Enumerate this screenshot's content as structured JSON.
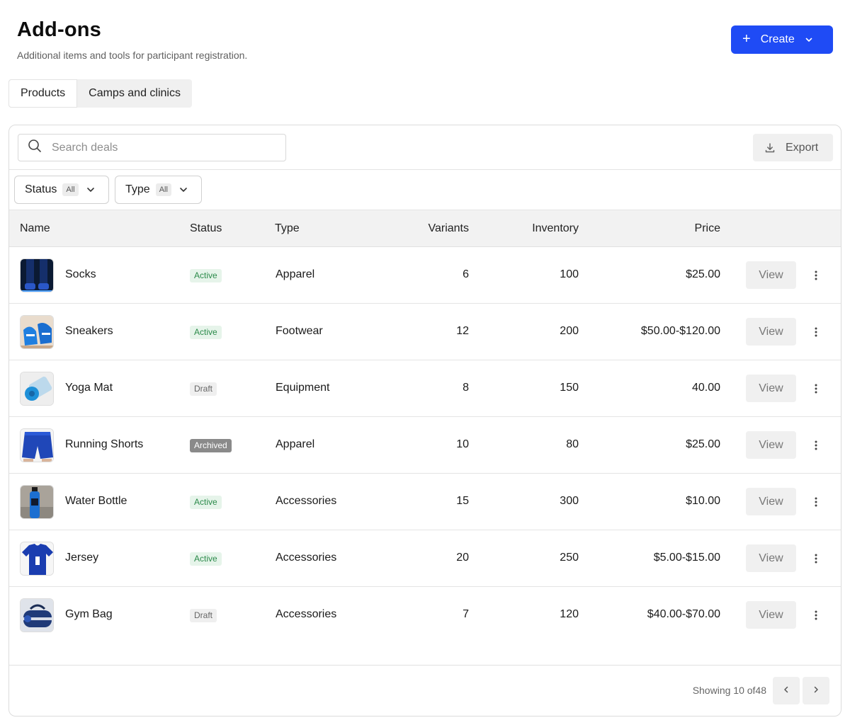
{
  "header": {
    "title": "Add-ons",
    "subtitle": "Additional items and tools for participant registration.",
    "create_label": "Create",
    "accent_color": "#1f4bf5"
  },
  "tabs": [
    {
      "label": "Products",
      "active": true
    },
    {
      "label": "Camps and clinics",
      "active": false
    }
  ],
  "toolbar": {
    "search_placeholder": "Search deals",
    "export_label": "Export"
  },
  "filters": [
    {
      "label": "Status",
      "value": "All"
    },
    {
      "label": "Type",
      "value": "All"
    }
  ],
  "table": {
    "columns": [
      "Name",
      "Status",
      "Type",
      "Variants",
      "Inventory",
      "Price"
    ],
    "view_label": "View",
    "rows": [
      {
        "name": "Socks",
        "status": "Active",
        "type": "Apparel",
        "variants": "6",
        "inventory": "100",
        "price": "$25.00",
        "image": "socks-image"
      },
      {
        "name": "Sneakers",
        "status": "Active",
        "type": "Footwear",
        "variants": "12",
        "inventory": "200",
        "price": "$50.00-$120.00",
        "image": "sneakers-image"
      },
      {
        "name": "Yoga Mat",
        "status": "Draft",
        "type": "Equipment",
        "variants": "8",
        "inventory": "150",
        "price": "40.00",
        "image": "yoga-mat-image"
      },
      {
        "name": "Running Shorts",
        "status": "Archived",
        "type": "Apparel",
        "variants": "10",
        "inventory": "80",
        "price": "$25.00",
        "image": "running-shorts-image"
      },
      {
        "name": "Water Bottle",
        "status": "Active",
        "type": "Accessories",
        "variants": "15",
        "inventory": "300",
        "price": "$10.00",
        "image": "water-bottle-image"
      },
      {
        "name": "Jersey",
        "status": "Active",
        "type": "Accessories",
        "variants": "20",
        "inventory": "250",
        "price": "$5.00-$15.00",
        "image": "jersey-image"
      },
      {
        "name": "Gym Bag",
        "status": "Draft",
        "type": "Accessories",
        "variants": "7",
        "inventory": "120",
        "price": "$40.00-$70.00",
        "image": "gym-bag-image"
      }
    ]
  },
  "footer": {
    "showing_text": "Showing 10 of48"
  },
  "icons": {
    "create": "plus-icon",
    "dropdown": "chevron-down-icon",
    "search": "search-icon",
    "export": "download-icon",
    "more": "more-vertical-icon",
    "prev": "chevron-left-icon",
    "next": "chevron-right-icon"
  }
}
